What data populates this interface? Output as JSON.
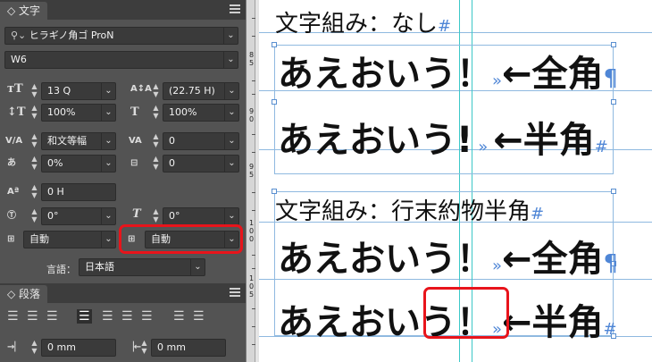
{
  "character_panel": {
    "tab_label": "◇ 文字",
    "font_family": "ヒラギノ角ゴ ProN",
    "font_style": "W6",
    "size": "13 Q",
    "leading": "(22.75 H)",
    "vertical_scale": "100%",
    "horizontal_scale": "100%",
    "kerning": "和文等幅",
    "tracking": "0",
    "tsume": "0%",
    "baseline_grid": "0",
    "baseline_shift": "0 H",
    "rotation": "0°",
    "skew": "0°",
    "aki_before": "自動",
    "aki_after": "自動",
    "language_label": "言語：",
    "language": "日本語"
  },
  "paragraph_panel": {
    "tab_label": "◇ 段落",
    "left_indent": "0 mm",
    "right_indent": "0 mm"
  },
  "ruler": {
    "labels": [
      "8",
      "5",
      "9",
      "0",
      "9",
      "5",
      "1",
      "0",
      "0",
      "1",
      "0",
      "5"
    ]
  },
  "document": {
    "section1_heading": "文字組み：なし",
    "section1_heading_mark": "#",
    "s1_line1_text": "あえおいう！",
    "s1_line1_mark": "»",
    "s1_line1_arrow": "←全角",
    "s1_line1_end": "¶",
    "s1_line2_text": "あえおいう!",
    "s1_line2_mark": "»",
    "s1_line2_arrow": "←半角",
    "s1_line2_end": "#",
    "section2_heading": "文字組み：行末約物半角",
    "section2_heading_mark": "#",
    "s2_line1_text": "あえおいう！",
    "s2_line1_mark": "»",
    "s2_line1_arrow": "←全角",
    "s2_line1_end": "¶",
    "s2_line2_text_a": "あえおい",
    "s2_line2_text_b": "う！",
    "s2_line2_mark": "»",
    "s2_line2_arrow": "←半角",
    "s2_line2_end": "#"
  },
  "colors": {
    "panel_bg": "#535353",
    "highlight_red": "#e8141b",
    "guide_blue": "#8fb9e0",
    "guide_cyan": "#3cc8c8",
    "mark_blue": "#4f86d6"
  }
}
